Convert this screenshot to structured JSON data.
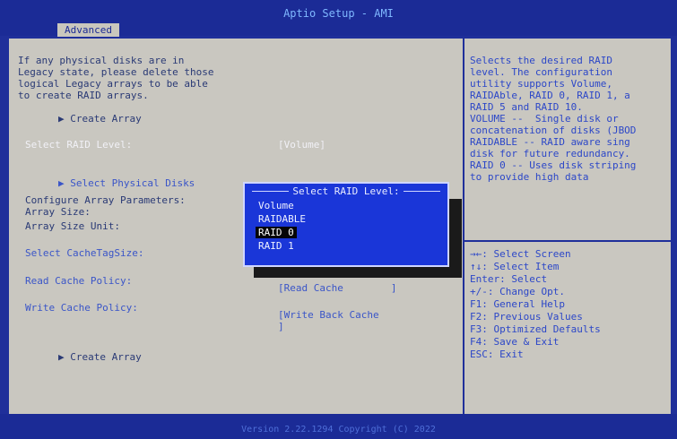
{
  "header": {
    "title": "Aptio Setup - AMI",
    "tab_advanced": "Advanced"
  },
  "left": {
    "info_lines": [
      "If any physical disks are in",
      "Legacy state, please delete those",
      "logical Legacy arrays to be able",
      "to create RAID arrays."
    ],
    "create_array_top": "Create Array",
    "select_raid_level_label": "Select RAID Level:",
    "select_raid_level_value": "[Volume]",
    "select_physical_disks": "Select Physical Disks",
    "configure_params": "Configure Array Parameters:",
    "array_size": "Array Size:",
    "array_size_unit": "Array Size Unit:",
    "select_cache_tag_size": "Select CacheTagSize:",
    "read_cache_policy_label": "Read Cache Policy:",
    "read_cache_policy_value": "[Read Cache        ]",
    "write_cache_policy_label": "Write Cache Policy:",
    "write_cache_policy_value_line1": "[Write Back Cache",
    "write_cache_policy_value_line2": "]",
    "create_array_bottom": "Create Array"
  },
  "popup": {
    "title": "Select RAID Level:",
    "options": [
      "Volume",
      "RAIDABLE",
      "RAID 0",
      "RAID 1"
    ],
    "selected": "RAID 0"
  },
  "help": {
    "lines": [
      "Selects the desired RAID",
      "level. The configuration",
      "utility supports Volume,",
      "RAIDAble, RAID 0, RAID 1, a",
      "RAID 5 and RAID 10.",
      "VOLUME --  Single disk or",
      "concatenation of disks (JBOD",
      "RAIDABLE -- RAID aware sing",
      "disk for future redundancy.",
      "RAID 0 -- Uses disk striping",
      "to provide high data"
    ]
  },
  "keys": {
    "lines": [
      "→←: Select Screen",
      "↑↓: Select Item",
      "Enter: Select",
      "+/-: Change Opt.",
      "F1: General Help",
      "F2: Previous Values",
      "F3: Optimized Defaults",
      "F4: Save & Exit",
      "ESC: Exit"
    ]
  },
  "footer": {
    "text": "Version 2.22.1294 Copyright (C) 2022"
  },
  "colors": {
    "frame_blue": "#1f2f9a",
    "panel_gray": "#c9c7c0",
    "popup_blue": "#1a36d8",
    "help_blue": "#2c47c8"
  },
  "icons": {
    "menu_arrow": "triangle-right-icon"
  }
}
